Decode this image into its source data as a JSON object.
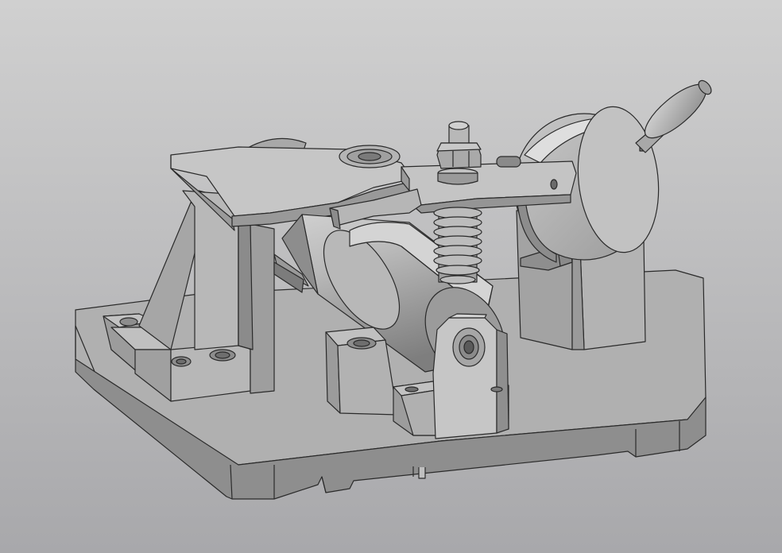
{
  "scene": {
    "colors": {
      "background_top": "#d0d0d0",
      "background_bottom": "#a8a8ab",
      "part_light": "#c4c4c4",
      "part_mid": "#a9a9a9",
      "part_dark": "#8a8a8a",
      "edge": "#2a2a2a"
    },
    "parts": [
      "base-plate",
      "left-support-bracket",
      "swing-lever-plate",
      "cylinder",
      "front-clevis-bracket",
      "support-block",
      "compression-spring",
      "adjusting-nut",
      "arm-lever",
      "eccentric-disc",
      "handle-knob",
      "right-support-block"
    ]
  }
}
